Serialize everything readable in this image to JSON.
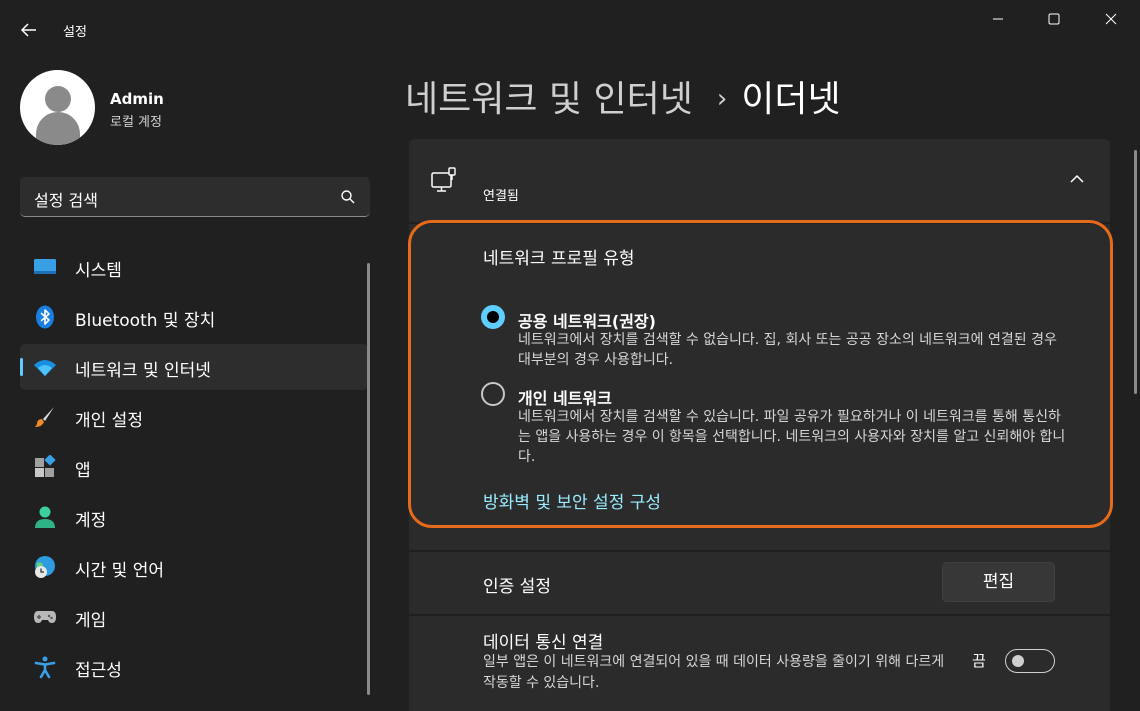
{
  "app": {
    "title": "설정"
  },
  "user": {
    "name": "Admin",
    "account_type": "로컬 계정"
  },
  "search": {
    "placeholder": "설정 검색"
  },
  "nav": {
    "items": [
      {
        "label": "시스템",
        "icon": "system-icon",
        "active": false
      },
      {
        "label": "Bluetooth 및 장치",
        "icon": "bluetooth-icon",
        "active": false
      },
      {
        "label": "네트워크 및 인터넷",
        "icon": "wifi-icon",
        "active": true
      },
      {
        "label": "개인 설정",
        "icon": "brush-icon",
        "active": false
      },
      {
        "label": "앱",
        "icon": "apps-icon",
        "active": false
      },
      {
        "label": "계정",
        "icon": "account-icon",
        "active": false
      },
      {
        "label": "시간 및 언어",
        "icon": "globe-clock-icon",
        "active": false
      },
      {
        "label": "게임",
        "icon": "gamepad-icon",
        "active": false
      },
      {
        "label": "접근성",
        "icon": "accessibility-icon",
        "active": false
      }
    ]
  },
  "breadcrumb": {
    "parent": "네트워크 및 인터넷",
    "separator": "›",
    "current": "이더넷"
  },
  "connection": {
    "status": "연결됨",
    "icon": "ethernet-icon"
  },
  "network_profile": {
    "title": "네트워크 프로필 유형",
    "options": [
      {
        "label": "공용 네트워크(권장)",
        "description": "네트워크에서 장치를 검색할 수 없습니다. 집, 회사 또는 공공 장소의 네트워크에 연결된 경우 대부분의 경우 사용합니다.",
        "selected": true
      },
      {
        "label": "개인 네트워크",
        "description": "네트워크에서 장치를 검색할 수 있습니다. 파일 공유가 필요하거나 이 네트워크를 통해 통신하는 앱을 사용하는 경우 이 항목을 선택합니다. 네트워크의 사용자와 장치를 알고 신뢰해야 합니다.",
        "selected": false
      }
    ],
    "firewall_link": "방화벽 및 보안 설정 구성"
  },
  "auth": {
    "label": "인증 설정",
    "button": "편집"
  },
  "metered": {
    "title": "데이터 통신 연결",
    "description": "일부 앱은 이 네트워크에 연결되어 있을 때 데이터 사용량을 줄이기 위해 다르게 작동할 수 있습니다.",
    "toggle_state": "끔",
    "enabled": false
  },
  "colors": {
    "accent": "#60cdff",
    "link": "#99ebff",
    "highlight": "#e56a1a",
    "background": "#202020",
    "card": "#2b2b2b"
  }
}
